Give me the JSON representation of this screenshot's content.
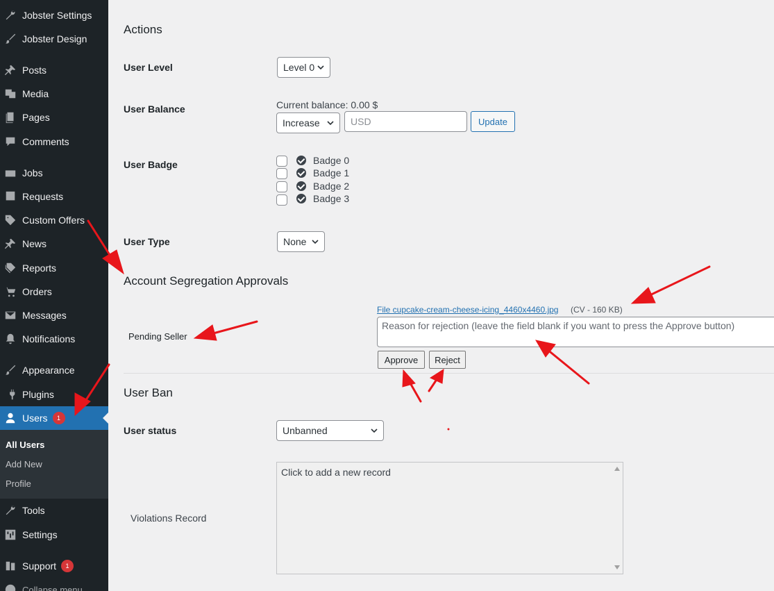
{
  "sidebar": {
    "items": [
      {
        "label": "Jobster Settings",
        "icon": "wrench-icon"
      },
      {
        "label": "Jobster Design",
        "icon": "brush-icon"
      },
      {
        "label": "Posts",
        "icon": "pin-icon"
      },
      {
        "label": "Media",
        "icon": "media-icon"
      },
      {
        "label": "Pages",
        "icon": "pages-icon"
      },
      {
        "label": "Comments",
        "icon": "comment-icon"
      },
      {
        "label": "Jobs",
        "icon": "job-icon"
      },
      {
        "label": "Requests",
        "icon": "question-icon"
      },
      {
        "label": "Custom Offers",
        "icon": "tag-icon"
      },
      {
        "label": "News",
        "icon": "pin-icon"
      },
      {
        "label": "Reports",
        "icon": "tags-icon"
      },
      {
        "label": "Orders",
        "icon": "cart-icon"
      },
      {
        "label": "Messages",
        "icon": "envelope-icon"
      },
      {
        "label": "Notifications",
        "icon": "bell-icon"
      },
      {
        "label": "Appearance",
        "icon": "brush-icon"
      },
      {
        "label": "Plugins",
        "icon": "plugin-icon"
      },
      {
        "label": "Users",
        "icon": "user-icon",
        "badge": "1"
      },
      {
        "label": "Tools",
        "icon": "wrench-icon"
      },
      {
        "label": "Settings",
        "icon": "settings-icon"
      },
      {
        "label": "Support",
        "icon": "support-icon",
        "badge": "1"
      },
      {
        "label": "Collapse menu",
        "icon": "collapse-icon"
      }
    ],
    "submenu": [
      "All Users",
      "Add New",
      "Profile"
    ]
  },
  "actions": {
    "heading": "Actions",
    "user_level": {
      "label": "User Level",
      "value": "Level 0"
    },
    "user_balance": {
      "label": "User Balance",
      "current": "Current balance: 0.00 $",
      "operation": "Increase",
      "amount_placeholder": "USD",
      "update_label": "Update"
    },
    "user_badge": {
      "label": "User Badge",
      "badges": [
        "Badge 0",
        "Badge 1",
        "Badge 2",
        "Badge 3"
      ]
    },
    "user_type": {
      "label": "User Type",
      "value": "None"
    }
  },
  "segregation": {
    "heading": "Account Segregation Approvals",
    "pending_label": "Pending Seller",
    "file_link": "File cupcake-cream-cheese-icing_4460x4460.jpg",
    "file_meta": "(CV - 160 KB)",
    "reason_placeholder": "Reason for rejection (leave the field blank if you want to press the Approve button)",
    "approve_label": "Approve",
    "reject_label": "Reject"
  },
  "ban": {
    "heading": "User Ban",
    "status_label": "User status",
    "status_value": "Unbanned",
    "violations_label": "Violations Record",
    "record_text": "Click to add a new record"
  },
  "colors": {
    "sidebar_bg": "#1d2327",
    "accent": "#2271b1",
    "badge_red": "#d63638",
    "annotation_arrow": "#e8161b"
  }
}
